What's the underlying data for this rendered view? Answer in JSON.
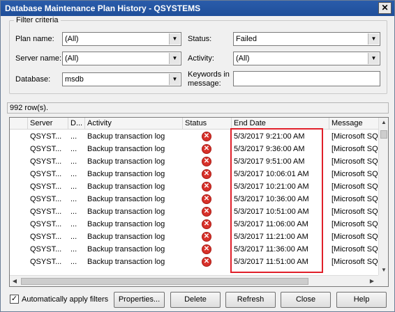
{
  "window": {
    "title": "Database Maintenance Plan History - QSYSTEMS",
    "close_glyph": "✕"
  },
  "filter": {
    "legend": "Filter criteria",
    "plan_name_label": "Plan name:",
    "plan_name_value": "(All)",
    "server_name_label": "Server name:",
    "server_name_value": "(All)",
    "database_label": "Database:",
    "database_value": "msdb",
    "status_label": "Status:",
    "status_value": "Failed",
    "activity_label": "Activity:",
    "activity_value": "(All)",
    "keywords_label_line1": "Keywords in",
    "keywords_label_line2": "message:",
    "keywords_value": ""
  },
  "row_count": "992 row(s).",
  "grid": {
    "columns": [
      "Server",
      "D...",
      "Activity",
      "Status",
      "End Date",
      "Message"
    ],
    "rows": [
      {
        "server": "QSYST...",
        "d": "...",
        "activity": "Backup transaction log",
        "status": "failed",
        "end_date": "5/3/2017 9:21:00 AM",
        "message": "[Microsoft SQL"
      },
      {
        "server": "QSYST...",
        "d": "...",
        "activity": "Backup transaction log",
        "status": "failed",
        "end_date": "5/3/2017 9:36:00 AM",
        "message": "[Microsoft SQL"
      },
      {
        "server": "QSYST...",
        "d": "...",
        "activity": "Backup transaction log",
        "status": "failed",
        "end_date": "5/3/2017 9:51:00 AM",
        "message": "[Microsoft SQL"
      },
      {
        "server": "QSYST...",
        "d": "...",
        "activity": "Backup transaction log",
        "status": "failed",
        "end_date": "5/3/2017 10:06:01 AM",
        "message": "[Microsoft SQL"
      },
      {
        "server": "QSYST...",
        "d": "...",
        "activity": "Backup transaction log",
        "status": "failed",
        "end_date": "5/3/2017 10:21:00 AM",
        "message": "[Microsoft SQL"
      },
      {
        "server": "QSYST...",
        "d": "...",
        "activity": "Backup transaction log",
        "status": "failed",
        "end_date": "5/3/2017 10:36:00 AM",
        "message": "[Microsoft SQL"
      },
      {
        "server": "QSYST...",
        "d": "...",
        "activity": "Backup transaction log",
        "status": "failed",
        "end_date": "5/3/2017 10:51:00 AM",
        "message": "[Microsoft SQL"
      },
      {
        "server": "QSYST...",
        "d": "...",
        "activity": "Backup transaction log",
        "status": "failed",
        "end_date": "5/3/2017 11:06:00 AM",
        "message": "[Microsoft SQL"
      },
      {
        "server": "QSYST...",
        "d": "...",
        "activity": "Backup transaction log",
        "status": "failed",
        "end_date": "5/3/2017 11:21:00 AM",
        "message": "[Microsoft SQL"
      },
      {
        "server": "QSYST...",
        "d": "...",
        "activity": "Backup transaction log",
        "status": "failed",
        "end_date": "5/3/2017 11:36:00 AM",
        "message": "[Microsoft SQL"
      },
      {
        "server": "QSYST...",
        "d": "...",
        "activity": "Backup transaction log",
        "status": "failed",
        "end_date": "5/3/2017 11:51:00 AM",
        "message": "[Microsoft SQL"
      }
    ],
    "status_icon": "error-x-icon",
    "status_glyph": "✕"
  },
  "footer": {
    "auto_apply_label": "Automatically apply filters",
    "auto_apply_checked": true,
    "properties": "Properties...",
    "delete": "Delete",
    "refresh": "Refresh",
    "close": "Close",
    "help": "Help"
  },
  "colors": {
    "highlight": "#e0202a",
    "titlebar": "#1f4f9a",
    "error": "#d8312a"
  }
}
